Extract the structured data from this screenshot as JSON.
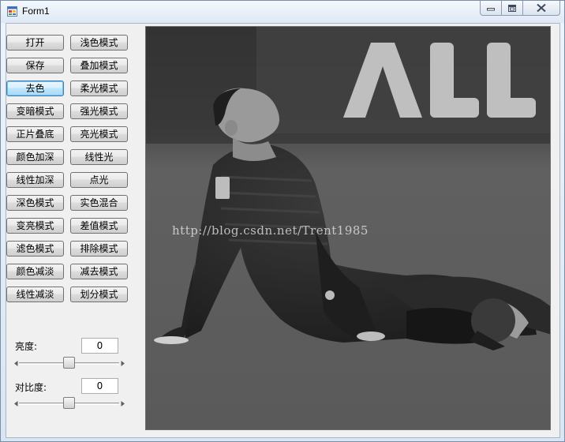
{
  "window": {
    "title": "Form1",
    "app_icon": "form-app-icon",
    "controls": [
      "minimize-icon",
      "maximize-icon",
      "close-icon"
    ]
  },
  "buttons_left": [
    "打开",
    "保存",
    "去色",
    "变暗模式",
    "正片叠底",
    "颜色加深",
    "线性加深",
    "深色模式",
    "变亮模式",
    "滤色模式",
    "颜色减淡",
    "线性减淡"
  ],
  "buttons_right": [
    "浅色模式",
    "叠加模式",
    "柔光模式",
    "强光模式",
    "亮光模式",
    "线性光",
    "点光",
    "实色混合",
    "差值模式",
    "排除模式",
    "减去模式",
    "划分模式"
  ],
  "focused_button": "去色",
  "brightness": {
    "label": "亮度:",
    "value": "0",
    "slider_level": 0.5
  },
  "contrast": {
    "label": "对比度:",
    "value": "0",
    "slider_level": 0.5
  },
  "image": {
    "description_icon": "grayscale-photo",
    "watermark": "http://blog.csdn.net/Trent1985"
  },
  "colors": {
    "titlebar": "#dfe9f5",
    "client": "#f0f0f0",
    "focus_border": "#3c7fb1"
  }
}
